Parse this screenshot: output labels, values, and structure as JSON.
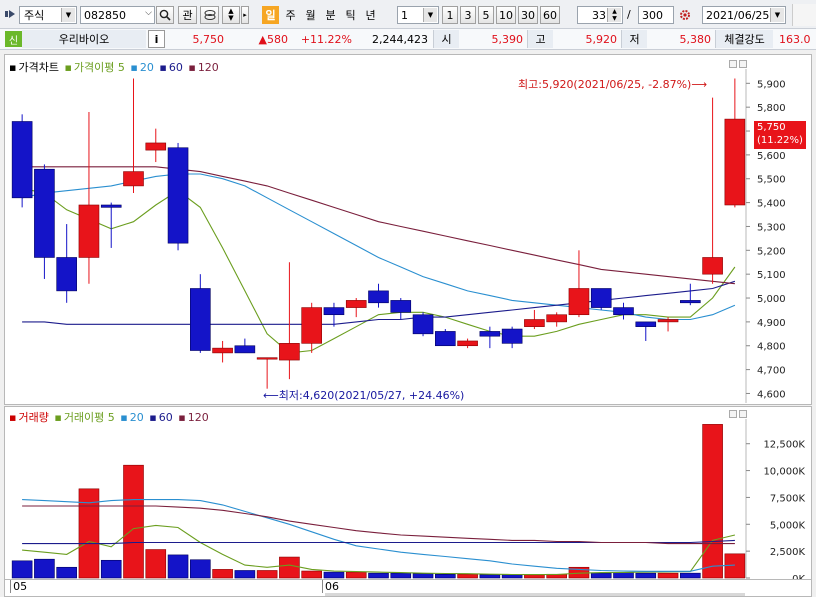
{
  "toolbar": {
    "market": "주식",
    "code": "082850",
    "btn_gwan": "관",
    "period_tabs": [
      {
        "label": "일",
        "active": true
      },
      {
        "label": "주",
        "active": false
      },
      {
        "label": "월",
        "active": false
      },
      {
        "label": "분",
        "active": false
      },
      {
        "label": "틱",
        "active": false
      },
      {
        "label": "년",
        "active": false
      }
    ],
    "interval": "1",
    "quick_intervals": [
      "1",
      "3",
      "5",
      "10",
      "30",
      "60"
    ],
    "view_count": "33",
    "separator": "/",
    "total_count": "300",
    "date": "2021/06/25"
  },
  "info": {
    "badge": "신",
    "name": "우리바이오",
    "info_btn": "i",
    "price": "5,750",
    "change": "▲580",
    "change_pct": "+11.22%",
    "volume": "2,244,423",
    "open_label": "시",
    "open": "5,390",
    "high_label": "고",
    "high": "5,920",
    "low_label": "저",
    "low": "5,380",
    "strength_label": "체결강도",
    "strength": "163.0"
  },
  "price_panel": {
    "legend": [
      {
        "text": "가격차트",
        "color": "#000000"
      },
      {
        "text": "가격이평 5",
        "color": "#6b9e1f"
      },
      {
        "text": "20",
        "color": "#2a8fd0"
      },
      {
        "text": "60",
        "color": "#1c1c8c"
      },
      {
        "text": "120",
        "color": "#7a1f3c"
      }
    ],
    "high_annotation": "최고:5,920(2021/06/25, -2.87%)⟶",
    "low_annotation": "⟵최저:4,620(2021/05/27, +24.46%)",
    "current_price": "5,750",
    "current_pct": "(11.22%)"
  },
  "volume_panel": {
    "legend": [
      {
        "text": "거래량",
        "color": "#cc0000"
      },
      {
        "text": "거래이평 5",
        "color": "#6b9e1f"
      },
      {
        "text": "20",
        "color": "#2a8fd0"
      },
      {
        "text": "60",
        "color": "#1c1c8c"
      },
      {
        "text": "120",
        "color": "#7a1f3c"
      }
    ]
  },
  "x_axis_labels": [
    {
      "label": "05",
      "index": 0
    },
    {
      "label": "06",
      "index": 14
    }
  ],
  "chart_data": [
    {
      "type": "candlestick",
      "title": "가격차트",
      "yticks": [
        4600,
        4700,
        4800,
        4900,
        5000,
        5100,
        5200,
        5300,
        5400,
        5500,
        5600,
        5700,
        5800,
        5900
      ],
      "ylim": [
        4560,
        5960
      ],
      "up_color": "#e8141a",
      "down_color": "#1414c8",
      "candles": [
        {
          "o": 5740,
          "h": 5770,
          "l": 5380,
          "c": 5420
        },
        {
          "o": 5540,
          "h": 5560,
          "l": 5080,
          "c": 5170
        },
        {
          "o": 5170,
          "h": 5310,
          "l": 4980,
          "c": 5030
        },
        {
          "o": 5170,
          "h": 5780,
          "l": 5060,
          "c": 5390
        },
        {
          "o": 5390,
          "h": 5400,
          "l": 5210,
          "c": 5380
        },
        {
          "o": 5470,
          "h": 5920,
          "l": 5440,
          "c": 5530
        },
        {
          "o": 5620,
          "h": 5710,
          "l": 5570,
          "c": 5650
        },
        {
          "o": 5630,
          "h": 5650,
          "l": 5200,
          "c": 5230
        },
        {
          "o": 5040,
          "h": 5100,
          "l": 4770,
          "c": 4780
        },
        {
          "o": 4770,
          "h": 4820,
          "l": 4730,
          "c": 4790
        },
        {
          "o": 4800,
          "h": 4830,
          "l": 4770,
          "c": 4770
        },
        {
          "o": 4750,
          "h": 4750,
          "l": 4620,
          "c": 4750
        },
        {
          "o": 4740,
          "h": 5150,
          "l": 4660,
          "c": 4810
        },
        {
          "o": 4810,
          "h": 4980,
          "l": 4770,
          "c": 4960
        },
        {
          "o": 4960,
          "h": 4980,
          "l": 4880,
          "c": 4930
        },
        {
          "o": 4960,
          "h": 5000,
          "l": 4920,
          "c": 4990
        },
        {
          "o": 5030,
          "h": 5060,
          "l": 4960,
          "c": 4980
        },
        {
          "o": 4990,
          "h": 5000,
          "l": 4910,
          "c": 4940
        },
        {
          "o": 4930,
          "h": 4940,
          "l": 4840,
          "c": 4850
        },
        {
          "o": 4860,
          "h": 4870,
          "l": 4800,
          "c": 4800
        },
        {
          "o": 4800,
          "h": 4830,
          "l": 4790,
          "c": 4820
        },
        {
          "o": 4860,
          "h": 4880,
          "l": 4790,
          "c": 4840
        },
        {
          "o": 4870,
          "h": 4880,
          "l": 4790,
          "c": 4810
        },
        {
          "o": 4880,
          "h": 4950,
          "l": 4870,
          "c": 4910
        },
        {
          "o": 4900,
          "h": 4940,
          "l": 4880,
          "c": 4930
        },
        {
          "o": 4930,
          "h": 5200,
          "l": 4920,
          "c": 5040
        },
        {
          "o": 5040,
          "h": 5040,
          "l": 4950,
          "c": 4960
        },
        {
          "o": 4960,
          "h": 4980,
          "l": 4910,
          "c": 4930
        },
        {
          "o": 4900,
          "h": 4900,
          "l": 4820,
          "c": 4880
        },
        {
          "o": 4900,
          "h": 4920,
          "l": 4860,
          "c": 4910
        },
        {
          "o": 4990,
          "h": 5060,
          "l": 4970,
          "c": 4980
        },
        {
          "o": 5100,
          "h": 5840,
          "l": 5060,
          "c": 5170
        },
        {
          "o": 5390,
          "h": 5920,
          "l": 5380,
          "c": 5750
        }
      ],
      "ma": [
        {
          "name": "5",
          "color": "#6b9e1f",
          "values": [
            5460,
            5440,
            5370,
            5330,
            5290,
            5320,
            5390,
            5450,
            5380,
            5210,
            5030,
            4850,
            4770,
            4780,
            4830,
            4880,
            4930,
            4940,
            4940,
            4920,
            4890,
            4860,
            4840,
            4840,
            4860,
            4890,
            4910,
            4930,
            4930,
            4920,
            4920,
            5000,
            5130
          ]
        },
        {
          "name": "20",
          "color": "#2a8fd0",
          "values": [
            5420,
            5440,
            5450,
            5460,
            5470,
            5490,
            5510,
            5520,
            5520,
            5500,
            5470,
            5420,
            5370,
            5320,
            5270,
            5220,
            5170,
            5130,
            5090,
            5060,
            5030,
            5010,
            4990,
            4980,
            4970,
            4960,
            4950,
            4940,
            4920,
            4910,
            4910,
            4930,
            4970
          ]
        },
        {
          "name": "60",
          "color": "#1c1c8c",
          "values": [
            4900,
            4900,
            4890,
            4890,
            4890,
            4890,
            4890,
            4890,
            4890,
            4890,
            4890,
            4890,
            4890,
            4890,
            4890,
            4900,
            4910,
            4910,
            4920,
            4920,
            4930,
            4940,
            4950,
            4960,
            4970,
            4980,
            4990,
            5000,
            5010,
            5020,
            5030,
            5040,
            5070
          ]
        },
        {
          "name": "120",
          "color": "#7a1f3c",
          "values": [
            5550,
            5550,
            5550,
            5550,
            5550,
            5550,
            5550,
            5540,
            5530,
            5510,
            5490,
            5470,
            5440,
            5410,
            5380,
            5350,
            5320,
            5300,
            5280,
            5260,
            5240,
            5220,
            5200,
            5180,
            5160,
            5140,
            5120,
            5110,
            5100,
            5090,
            5080,
            5070,
            5060
          ]
        }
      ]
    },
    {
      "type": "bar",
      "title": "거래량",
      "yticks": [
        0,
        2500,
        5000,
        7500,
        10000,
        12500
      ],
      "ytick_labels": [
        "0K",
        "2,500K",
        "5,000K",
        "7,500K",
        "10,000K",
        "12,500K"
      ],
      "ylim": [
        0,
        14800
      ],
      "volumes": [
        1600,
        1750,
        1000,
        8300,
        1650,
        10500,
        2650,
        2150,
        1700,
        800,
        700,
        700,
        1950,
        650,
        550,
        550,
        450,
        450,
        400,
        350,
        350,
        300,
        300,
        300,
        350,
        1000,
        450,
        500,
        450,
        450,
        450,
        14300,
        2250
      ],
      "ma": [
        {
          "name": "5",
          "color": "#6b9e1f",
          "values": [
            2600,
            2400,
            2200,
            3400,
            2900,
            4600,
            4900,
            4700,
            3300,
            2200,
            1200,
            1000,
            1200,
            800,
            650,
            600,
            550,
            500,
            450,
            420,
            400,
            350,
            330,
            320,
            330,
            450,
            500,
            520,
            550,
            580,
            600,
            3500,
            4000
          ]
        },
        {
          "name": "20",
          "color": "#2a8fd0",
          "values": [
            7300,
            7200,
            7100,
            7000,
            7200,
            7300,
            7300,
            7300,
            7200,
            6800,
            6200,
            5600,
            5000,
            4300,
            3600,
            3000,
            2700,
            2400,
            2200,
            2000,
            1800,
            1600,
            1300,
            1100,
            900,
            800,
            700,
            650,
            620,
            620,
            620,
            1100,
            1200
          ]
        },
        {
          "name": "60",
          "color": "#1c1c8c",
          "values": [
            3200,
            3200,
            3200,
            3200,
            3200,
            3300,
            3300,
            3300,
            3300,
            3300,
            3300,
            3300,
            3300,
            3300,
            3300,
            3300,
            3300,
            3300,
            3300,
            3300,
            3300,
            3300,
            3300,
            3300,
            3300,
            3300,
            3300,
            3300,
            3300,
            3300,
            3300,
            3400,
            3500
          ]
        },
        {
          "name": "120",
          "color": "#7a1f3c",
          "values": [
            6700,
            6700,
            6700,
            6700,
            6700,
            6700,
            6700,
            6600,
            6500,
            6300,
            6000,
            5700,
            5300,
            5000,
            4700,
            4400,
            4200,
            4000,
            3900,
            3800,
            3700,
            3600,
            3500,
            3500,
            3400,
            3400,
            3300,
            3300,
            3300,
            3200,
            3200,
            3200,
            3200
          ]
        }
      ]
    }
  ]
}
